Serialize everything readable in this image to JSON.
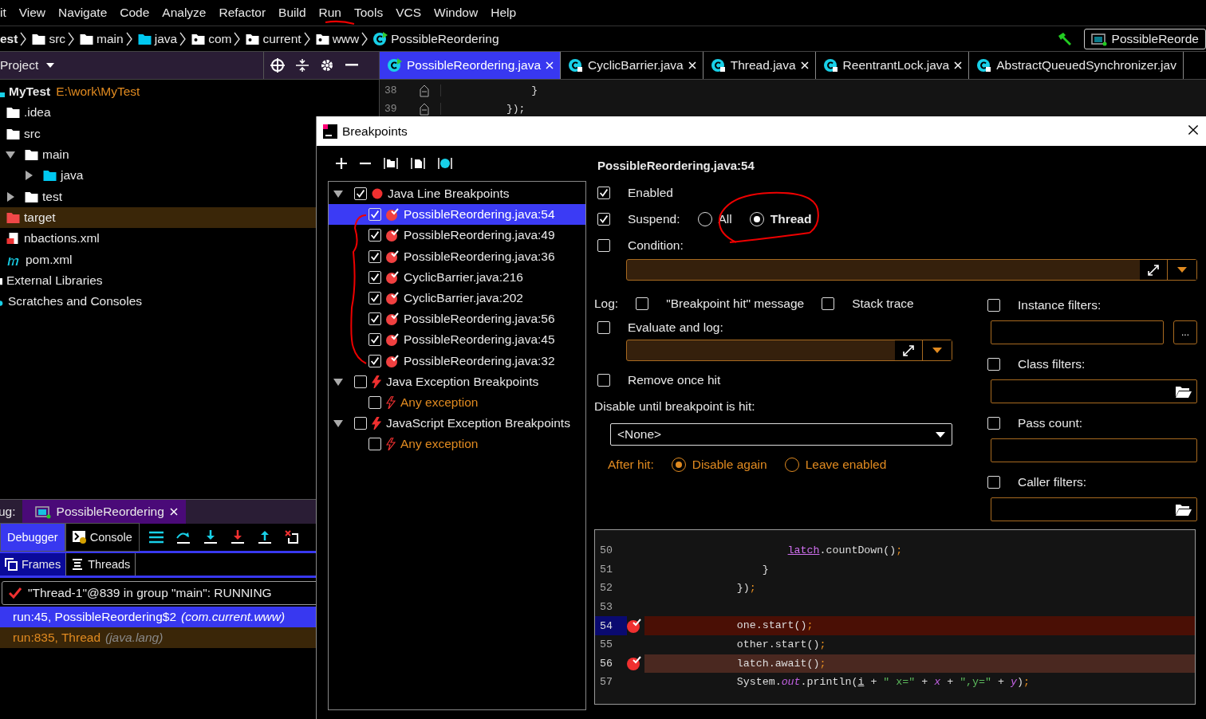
{
  "menu_bar": {
    "items": [
      "it",
      "View",
      "Navigate",
      "Code",
      "Analyze",
      "Refactor",
      "Build",
      "Run",
      "Tools",
      "VCS",
      "Window",
      "Help"
    ]
  },
  "breadcrumbs": [
    {
      "label": "est",
      "kind": "project"
    },
    {
      "label": "src",
      "kind": "folder"
    },
    {
      "label": "main",
      "kind": "folder"
    },
    {
      "label": "java",
      "kind": "source"
    },
    {
      "label": "com",
      "kind": "package"
    },
    {
      "label": "current",
      "kind": "package"
    },
    {
      "label": "www",
      "kind": "package"
    },
    {
      "label": "PossibleReordering",
      "kind": "class"
    }
  ],
  "run_config": "PossibleReorde",
  "project_panel": {
    "title": "Project",
    "tree": [
      {
        "label": "MyTest",
        "path": "E:\\work\\MyTest",
        "kind": "module",
        "selected": false,
        "children": [
          {
            "label": ".idea",
            "kind": "folder",
            "selected": false
          },
          {
            "label": "src",
            "kind": "folder",
            "selected": false,
            "children": [
              {
                "label": "main",
                "kind": "folder",
                "expanded": true,
                "selected": false,
                "children": [
                  {
                    "label": "java",
                    "kind": "source",
                    "expanded": false,
                    "selected": false
                  }
                ]
              },
              {
                "label": "test",
                "kind": "folder",
                "expanded": false,
                "selected": false
              }
            ]
          },
          {
            "label": "target",
            "kind": "excluded",
            "selected": true
          },
          {
            "label": "nbactions.xml",
            "kind": "xml",
            "selected": false
          },
          {
            "label": "pom.xml",
            "kind": "maven",
            "selected": false
          }
        ]
      },
      {
        "label": "External Libraries",
        "kind": "library",
        "selected": false
      },
      {
        "label": "Scratches and Consoles",
        "kind": "scratch",
        "selected": false
      }
    ]
  },
  "editor_tabs": [
    {
      "label": "PossibleReordering.java",
      "selected": true,
      "locked": false
    },
    {
      "label": "CyclicBarrier.java",
      "selected": false,
      "locked": true
    },
    {
      "label": "Thread.java",
      "selected": false,
      "locked": true
    },
    {
      "label": "ReentrantLock.java",
      "selected": false,
      "locked": true
    },
    {
      "label": "AbstractQueuedSynchronizer.jav",
      "selected": false,
      "locked": true
    }
  ],
  "editor_lines": [
    {
      "number": "38",
      "code": "              }"
    },
    {
      "number": "39",
      "code": "          });"
    }
  ],
  "debug_panel": {
    "label": "ug:",
    "session": "PossibleReordering",
    "tabs": [
      {
        "label": "Debugger",
        "selected": true
      },
      {
        "label": "Console",
        "selected": false
      }
    ],
    "frame_tabs": [
      {
        "label": "Frames",
        "selected": true
      },
      {
        "label": "Threads",
        "selected": false
      }
    ],
    "thread": "\"Thread-1\"@839 in group \"main\": RUNNING",
    "frames": [
      {
        "method": "run:45, PossibleReordering$2",
        "package": "(com.current.www)",
        "selected": true,
        "kind": "project"
      },
      {
        "method": "run:835, Thread",
        "package": "(java.lang)",
        "selected": false,
        "kind": "library"
      }
    ]
  },
  "dialog": {
    "title": "Breakpoints",
    "tree": [
      {
        "label": "Java Line Breakpoints",
        "kind": "line",
        "checked": true,
        "expanded": true,
        "children": [
          {
            "label": "PossibleReordering.java:54",
            "checked": true,
            "selected": true
          },
          {
            "label": "PossibleReordering.java:49",
            "checked": true,
            "selected": false
          },
          {
            "label": "PossibleReordering.java:36",
            "checked": true,
            "selected": false
          },
          {
            "label": "CyclicBarrier.java:216",
            "checked": true,
            "selected": false
          },
          {
            "label": "CyclicBarrier.java:202",
            "checked": true,
            "selected": false
          },
          {
            "label": "PossibleReordering.java:56",
            "checked": true,
            "selected": false
          },
          {
            "label": "PossibleReordering.java:45",
            "checked": true,
            "selected": false
          },
          {
            "label": "PossibleReordering.java:32",
            "checked": true,
            "selected": false
          }
        ]
      },
      {
        "label": "Java Exception Breakpoints",
        "kind": "exception",
        "checked": false,
        "expanded": true,
        "children": [
          {
            "label": "Any exception",
            "checked": false,
            "selected": false
          }
        ]
      },
      {
        "label": "JavaScript Exception Breakpoints",
        "kind": "exception",
        "checked": false,
        "expanded": true,
        "children": [
          {
            "label": "Any exception",
            "checked": false,
            "selected": false
          }
        ]
      }
    ],
    "details": {
      "heading": "PossibleReordering.java:54",
      "enabled": {
        "label": "Enabled",
        "checked": true
      },
      "suspend": {
        "label": "Suspend:",
        "checked": true,
        "options": [
          {
            "label": "All",
            "selected": false
          },
          {
            "label": "Thread",
            "selected": true
          }
        ]
      },
      "condition": {
        "label": "Condition:",
        "checked": false
      },
      "log_label": "Log:",
      "log_options": [
        {
          "label": "\"Breakpoint hit\" message",
          "checked": false
        },
        {
          "label": "Stack trace",
          "checked": false
        }
      ],
      "evaluate": {
        "label": "Evaluate and log:",
        "checked": false
      },
      "remove_once_hit": {
        "label": "Remove once hit",
        "checked": false
      },
      "disable_until": {
        "label": "Disable until breakpoint is hit:",
        "value": "<None>"
      },
      "after_hit": {
        "label": "After hit:",
        "options": [
          {
            "label": "Disable again",
            "selected": true
          },
          {
            "label": "Leave enabled",
            "selected": false
          }
        ]
      },
      "filters": [
        {
          "label": "Instance filters:",
          "checked": false,
          "kind": "dots",
          "button": "..."
        },
        {
          "label": "Class filters:",
          "checked": false,
          "kind": "folder"
        },
        {
          "label": "Pass count:",
          "checked": false,
          "kind": "plain"
        },
        {
          "label": "Caller filters:",
          "checked": false,
          "kind": "folder"
        }
      ]
    },
    "code_preview": [
      {
        "number": "50",
        "breakpoint": false,
        "current": false,
        "tokens": [
          {
            "text": "                    latch",
            "kind": "field"
          },
          {
            "text": ".countDown()",
            "kind": "plain"
          },
          {
            "text": ";",
            "kind": "punct"
          }
        ]
      },
      {
        "number": "51",
        "breakpoint": false,
        "current": false,
        "tokens": [
          {
            "text": "                }",
            "kind": "plain"
          }
        ]
      },
      {
        "number": "52",
        "breakpoint": false,
        "current": false,
        "tokens": [
          {
            "text": "            })",
            "kind": "plain"
          },
          {
            "text": ";",
            "kind": "punct"
          }
        ]
      },
      {
        "number": "53",
        "breakpoint": false,
        "current": false
      },
      {
        "number": "54",
        "breakpoint": true,
        "current": true,
        "tokens": [
          {
            "text": "            one.start()",
            "kind": "plain"
          },
          {
            "text": ";",
            "kind": "punct"
          }
        ]
      },
      {
        "number": "55",
        "breakpoint": false,
        "current": false,
        "tokens": [
          {
            "text": "            other.start()",
            "kind": "plain"
          },
          {
            "text": ";",
            "kind": "punct"
          }
        ]
      },
      {
        "number": "56",
        "breakpoint": true,
        "current": false,
        "tokens": [
          {
            "text": "            latch.await()",
            "kind": "plain"
          },
          {
            "text": ";",
            "kind": "punct"
          }
        ]
      },
      {
        "number": "57",
        "breakpoint": false,
        "current": false,
        "tokens": [
          {
            "text": "            System.",
            "kind": "plain"
          },
          {
            "text": "out",
            "kind": "static"
          },
          {
            "text": ".println(",
            "kind": "plain"
          },
          {
            "text": "i",
            "kind": "local"
          },
          {
            "text": " + ",
            "kind": "plain"
          },
          {
            "text": "\" x=\"",
            "kind": "string"
          },
          {
            "text": " + ",
            "kind": "plain"
          },
          {
            "text": "x",
            "kind": "static"
          },
          {
            "text": " + ",
            "kind": "plain"
          },
          {
            "text": "\",y=\"",
            "kind": "string"
          },
          {
            "text": " + ",
            "kind": "plain"
          },
          {
            "text": "y",
            "kind": "static"
          },
          {
            "text": ")",
            "kind": "plain"
          },
          {
            "text": ";",
            "kind": "punct"
          }
        ]
      }
    ]
  }
}
